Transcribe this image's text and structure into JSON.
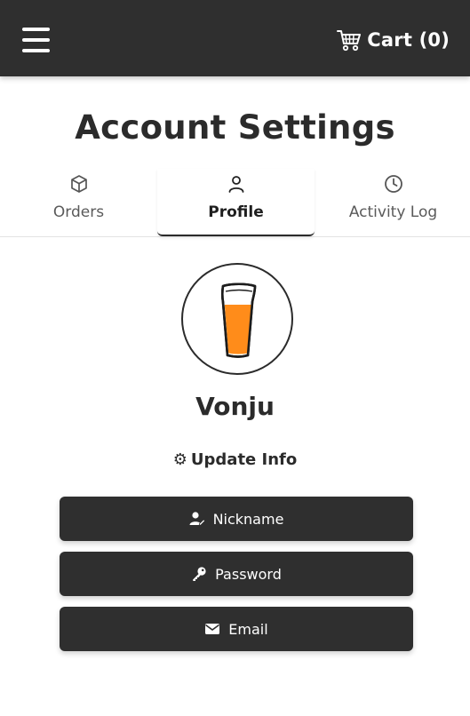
{
  "header": {
    "menu_icon": "hamburger-menu-icon",
    "cart_icon": "shopping-cart-icon",
    "cart_label": "Cart (0)"
  },
  "page": {
    "title": "Account Settings"
  },
  "tabs": [
    {
      "label": "Orders",
      "icon": "box-icon",
      "active": false
    },
    {
      "label": "Profile",
      "icon": "user-icon",
      "active": true
    },
    {
      "label": "Activity Log",
      "icon": "clock-icon",
      "active": false
    }
  ],
  "profile": {
    "avatar_icon": "beer-glass-icon",
    "username": "Vonju",
    "update_info_label": "Update Info",
    "update_info_icon": "gear-icon"
  },
  "actions": [
    {
      "label": "Nickname",
      "icon": "user-edit-icon"
    },
    {
      "label": "Password",
      "icon": "key-icon"
    },
    {
      "label": "Email",
      "icon": "envelope-icon"
    }
  ],
  "colors": {
    "header_bg": "#2f2f2f",
    "button_bg": "#2f2f2f",
    "text": "#2b2b2b",
    "beer": "#ff8c1a"
  }
}
